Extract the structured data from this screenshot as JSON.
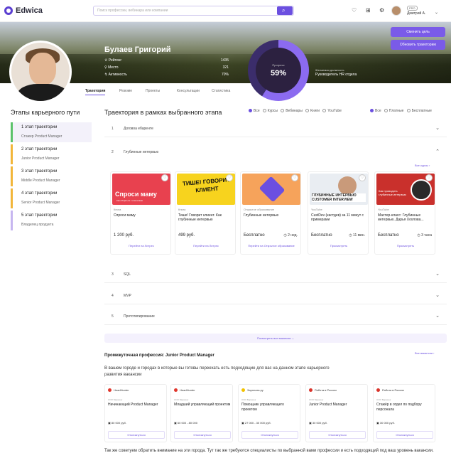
{
  "header": {
    "logo": "Edwica",
    "search_placeholder": "Поиск профессии, вебинара или компании",
    "user_badge": "PRO",
    "user_name": "Дмитрий А."
  },
  "profile": {
    "name": "Булаев Григорий",
    "stats": [
      {
        "label": "Рейтинг",
        "value": "1435"
      },
      {
        "label": "Место",
        "value": "321"
      },
      {
        "label": "Активность",
        "value": "70%"
      }
    ],
    "progress_label": "Прогресс",
    "progress_value": "59%",
    "progress_fraction": 0.59,
    "goal_label": "Желаемая должность",
    "goal_value": "Руководитель HR отдела",
    "change_goal": "Сменить цель",
    "update_path": "Обновить траекторию"
  },
  "tabs": [
    "Траектория",
    "Резюме",
    "Проекты",
    "Консультации",
    "Статистика"
  ],
  "sidebar": {
    "title": "Этапы карьерного пути",
    "stages": [
      {
        "title": "1 этап траектории",
        "role": "Стажер Product Manager",
        "color": "#5cc26b"
      },
      {
        "title": "2 этап траектории",
        "role": "Junior Product Manager",
        "color": "#f2b63a"
      },
      {
        "title": "3 этап траектории",
        "role": "Middle Product Manager",
        "color": "#f2b63a"
      },
      {
        "title": "4 этап траектории",
        "role": "Senior Product Manager",
        "color": "#f2b63a"
      },
      {
        "title": "5 этап траектории",
        "role": "Владелец продукта",
        "color": "#c6b6f0"
      }
    ]
  },
  "main": {
    "title": "Траектория в рамках выбранного этапа",
    "filters_type": [
      "Все",
      "Курсы",
      "Вебинары",
      "Книги",
      "YouTube"
    ],
    "filters_price": [
      "Все",
      "Платные",
      "Бесплатные"
    ],
    "sections": [
      {
        "num": "1",
        "label": "Договоа ебаренте"
      },
      {
        "num": "2",
        "label": "Глубинные интервью"
      },
      {
        "num": "3",
        "label": "SQL"
      },
      {
        "num": "4",
        "label": "MVP"
      },
      {
        "num": "5",
        "label": "Прототипирование"
      }
    ],
    "all_courses": "Все курсы",
    "courses": [
      {
        "provider": "Книга",
        "title": "Спроси маму",
        "price": "1 200 руб.",
        "duration": "",
        "action": "Перейти на Литрес",
        "cover_text": "Спроси маму",
        "cover_sub": "Как общаться с клиентами"
      },
      {
        "provider": "Книга",
        "title": "Тише! Говорит клиент. Как глубинные интервью",
        "price": "499 руб.",
        "duration": "",
        "action": "Перейти на Литрес",
        "cover_text": "ТИШЕ! ГОВОРИТ КЛИЕНТ"
      },
      {
        "provider": "Открытое образование",
        "title": "Глубинные интервью",
        "price": "Бесплатно",
        "duration": "2 нед.",
        "action": "Перейти на Открытое образование"
      },
      {
        "provider": "YouTube",
        "title": "CustDev (кастдев) за 11 минут с примерами",
        "price": "Бесплатно",
        "duration": "11 мин.",
        "action": "Просмотреть",
        "cover_text": "ГЛУБИННЫЕ ИНТЕРВЬЮ CUSTOMER INTERVIEW"
      },
      {
        "provider": "YouTube",
        "title": "Мастер-класс: Глубинные интервью. Дарья Хохлова...",
        "price": "Бесплатно",
        "duration": "3 часа",
        "action": "Просмотреть",
        "cover_text": "Как проводить глубинные интервью"
      }
    ],
    "show_all": "Посмотреть все вакансии"
  },
  "vacancies": {
    "title": "Промежуточная профессия: Junior Product Manager",
    "all_link": "Все вакансии",
    "description": "В вашем городе и городах в которые вы готовы переехать есть подходящие для вас на данном этапе карьерного развития вакансии",
    "items": [
      {
        "company": "HeadHunter",
        "sub": "ООО Барашек",
        "role": "Начинающий Product Manager",
        "salary": "80 000 руб.",
        "action": "Откликнуться",
        "logo": "#e0362c"
      },
      {
        "company": "HeadHunter",
        "sub": "ООО Барашек",
        "role": "Младший управляющий проектом",
        "salary": "60 000 - 80 000",
        "action": "Откликнуться",
        "logo": "#e0362c"
      },
      {
        "company": "Зарплата.ру",
        "sub": "ООО Барашек",
        "role": "Помощник управляющего проектом",
        "salary": "27 000 - 30 000 руб.",
        "action": "Откликнуться",
        "logo": "#f2c200"
      },
      {
        "company": "Работа в России",
        "sub": "ООО Барашек",
        "role": "Junior Product Manager",
        "salary": "30 000 руб.",
        "action": "Откликнуться",
        "logo": "#d9342b"
      },
      {
        "company": "Работа в России",
        "sub": "ООО Барашек",
        "role": "Стажёр в отдел по подбору персонала",
        "salary": "30 000 руб.",
        "action": "Откликнуться",
        "logo": "#d9342b"
      }
    ],
    "footer": "Так же советуем обратить внимание на эти города. Тут так же требуются специалисты по выбранной вами профессии и есть подходящий под ваш уровень вакансии."
  }
}
